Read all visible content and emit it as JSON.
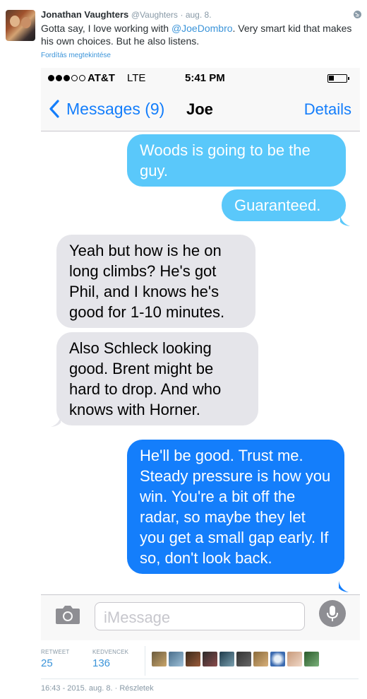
{
  "tweet": {
    "name": "Jonathan Vaughters",
    "handle": "@Vaughters",
    "date": "· aug. 8.",
    "text_before": "Gotta say, I love working with ",
    "mention": "@JoeDombro",
    "text_after": ". Very smart kid that makes his own choices. But he also listens.",
    "translate_label": "Fordítás megtekintése"
  },
  "phone": {
    "status": {
      "carrier": "AT&T",
      "network": "LTE",
      "time": "5:41 PM",
      "battery_level": 0.3
    },
    "nav": {
      "back_label": "Messages (9)",
      "title": "Joe",
      "details_label": "Details"
    },
    "messages": [
      {
        "side": "sent",
        "text": "Woods is going to be the guy."
      },
      {
        "side": "sent",
        "text": "Guaranteed."
      },
      {
        "side": "received",
        "text": "Yeah but how is he on long climbs? He's got Phil, and I knows he's good for 1-10 minutes."
      },
      {
        "side": "received",
        "text": "Also Schleck looking good. Brent might be hard to drop. And who knows with Horner."
      },
      {
        "side": "sent",
        "text": "He'll be good. Trust me. Steady pressure is how you win. You're a bit off the radar, so maybe they let you get a small gap early. If so, don't look back."
      }
    ],
    "input_placeholder": "iMessage"
  },
  "footer": {
    "retweets_label": "RETWEET",
    "retweets": "25",
    "favorites_label": "KEDVENCEK",
    "favorites": "136",
    "timestamp": "16:43 - 2015. aug. 8.",
    "details_link": "· Részletek"
  },
  "colors": {
    "ios_blue": "#147efb",
    "sent_light": "#5ac8fa",
    "received": "#e5e5ea",
    "twitter_link": "#3b94d9",
    "muted": "#8899a6"
  }
}
